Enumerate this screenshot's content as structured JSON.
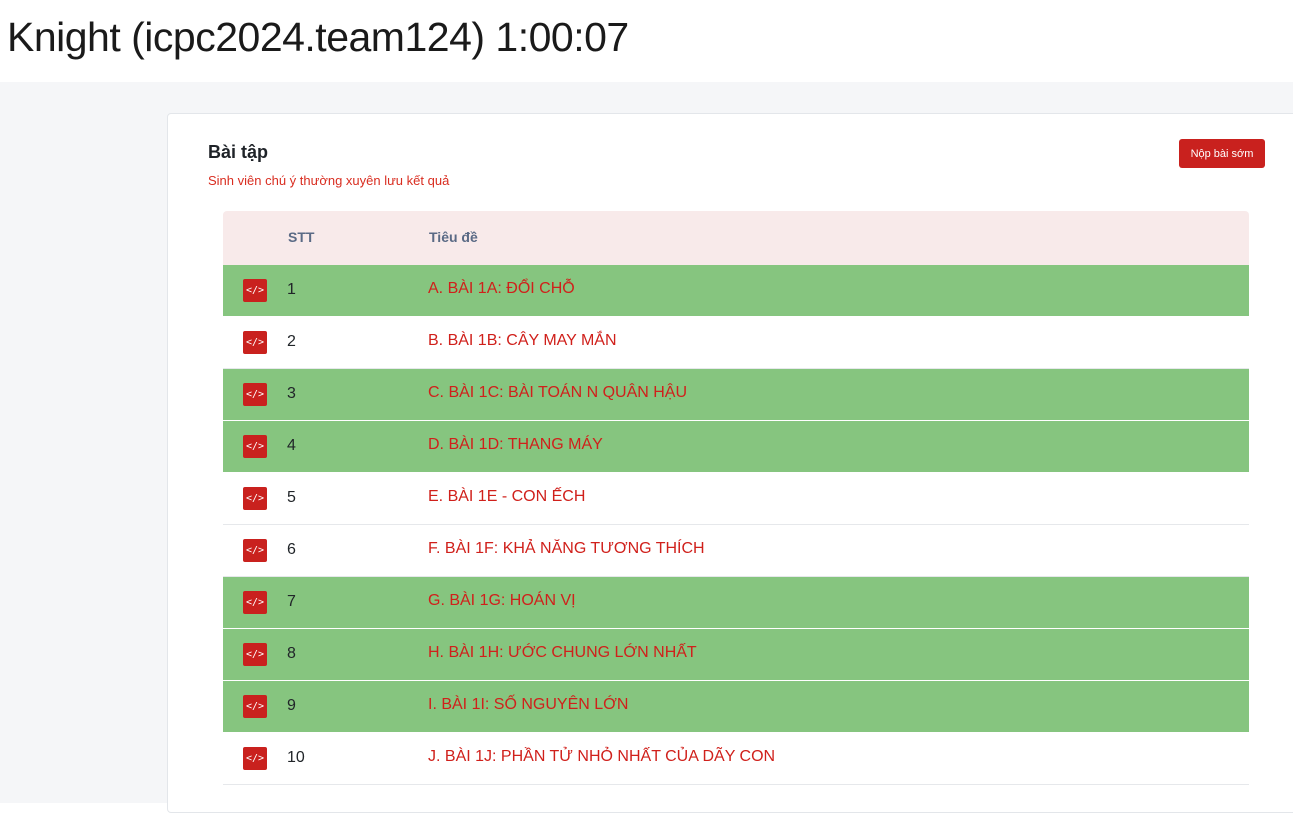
{
  "header": {
    "title": "Knight (icpc2024.team124) 1:00:07"
  },
  "card": {
    "title": "Bài tập",
    "subtitle": "Sinh viên chú ý thường xuyên lưu kết quả",
    "submit_label": "Nộp bài sớm"
  },
  "table": {
    "columns": [
      "STT",
      "Tiêu đề"
    ],
    "code_icon": "</>",
    "rows": [
      {
        "num": "1",
        "title": "A. BÀI 1A: ĐỔI CHỖ",
        "completed": true
      },
      {
        "num": "2",
        "title": "B. BÀI 1B: CÂY MAY MẮN",
        "completed": false
      },
      {
        "num": "3",
        "title": "C. BÀI 1C: BÀI TOÁN N QUÂN HẬU",
        "completed": true
      },
      {
        "num": "4",
        "title": "D. BÀI 1D: THANG MÁY",
        "completed": true
      },
      {
        "num": "5",
        "title": "E. BÀI 1E - CON ẾCH",
        "completed": false
      },
      {
        "num": "6",
        "title": "F. BÀI 1F: KHẢ NĂNG TƯƠNG THÍCH",
        "completed": false
      },
      {
        "num": "7",
        "title": "G. BÀI 1G: HOÁN VỊ",
        "completed": true
      },
      {
        "num": "8",
        "title": "H. BÀI 1H: ƯỚC CHUNG LỚN NHẤT",
        "completed": true
      },
      {
        "num": "9",
        "title": "I. BÀI 1I: SỐ NGUYÊN LỚN",
        "completed": true
      },
      {
        "num": "10",
        "title": "J. BÀI 1J: PHẦN TỬ NHỎ NHẤT CỦA DÃY CON",
        "completed": false
      }
    ]
  },
  "colors": {
    "accent": "#c9211e",
    "completed_row": "#86c57f",
    "header_row": "#f8eaea"
  }
}
